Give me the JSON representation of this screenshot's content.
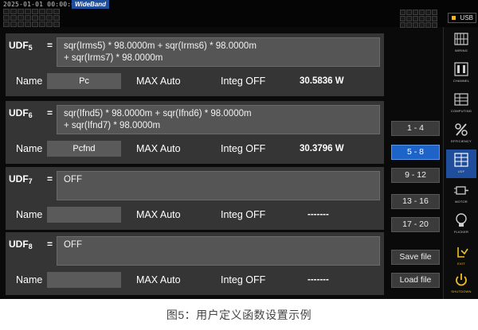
{
  "status": {
    "datetime": "2025-01-01 00:00:00",
    "mode_badge": "WideBand",
    "usb_label": "USB"
  },
  "udfs": [
    {
      "label": "UDF",
      "index": "5",
      "eq": "=",
      "expr_line1": "sqr(Irms5) * 98.0000m + sqr(Irms6) * 98.0000m",
      "expr_line2": "+ sqr(Irms7) * 98.0000m",
      "name_label": "Name",
      "name_value": "Pc",
      "max_label": "MAX Auto",
      "integ_label": "Integ OFF",
      "value": "30.5836  W"
    },
    {
      "label": "UDF",
      "index": "6",
      "eq": "=",
      "expr_line1": "sqr(Ifnd5) * 98.0000m + sqr(Ifnd6) * 98.0000m",
      "expr_line2": "+ sqr(Ifnd7) * 98.0000m",
      "name_label": "Name",
      "name_value": "Pcfnd",
      "max_label": "MAX Auto",
      "integ_label": "Integ OFF",
      "value": "30.3796  W"
    },
    {
      "label": "UDF",
      "index": "7",
      "eq": "=",
      "expr_line1": "OFF",
      "expr_line2": "",
      "name_label": "Name",
      "name_value": "",
      "max_label": "MAX Auto",
      "integ_label": "Integ OFF",
      "value": "-------"
    },
    {
      "label": "UDF",
      "index": "8",
      "eq": "=",
      "expr_line1": "OFF",
      "expr_line2": "",
      "name_label": "Name",
      "name_value": "",
      "max_label": "MAX Auto",
      "integ_label": "Integ OFF",
      "value": "-------"
    }
  ],
  "range_buttons": [
    "1 - 4",
    "5 - 8",
    "9 - 12",
    "13 - 16",
    "17 - 20"
  ],
  "active_range": "5 - 8",
  "file_buttons": {
    "save": "Save file",
    "load": "Load file"
  },
  "sidebar": {
    "items": [
      {
        "label": "WIRING",
        "icon": "wiring-icon"
      },
      {
        "label": "CHANNEL",
        "icon": "channel-icon"
      },
      {
        "label": "COMPUTING",
        "icon": "computing-icon"
      },
      {
        "label": "EFFICIENCY",
        "icon": "efficiency-icon"
      },
      {
        "label": "UDF",
        "icon": "udf-icon"
      },
      {
        "label": "MOTOR",
        "icon": "motor-icon"
      },
      {
        "label": "FLICKER",
        "icon": "flicker-icon"
      },
      {
        "label": "EXIT",
        "icon": "exit-icon"
      },
      {
        "label": "SHUTDOWN",
        "icon": "shutdown-icon"
      }
    ],
    "selected": "UDF"
  },
  "colors": {
    "accent": "#1e63c8",
    "panel": "#353535",
    "field": "#555555",
    "warning": "#f0c020"
  },
  "caption": "图5：用户定义函数设置示例"
}
